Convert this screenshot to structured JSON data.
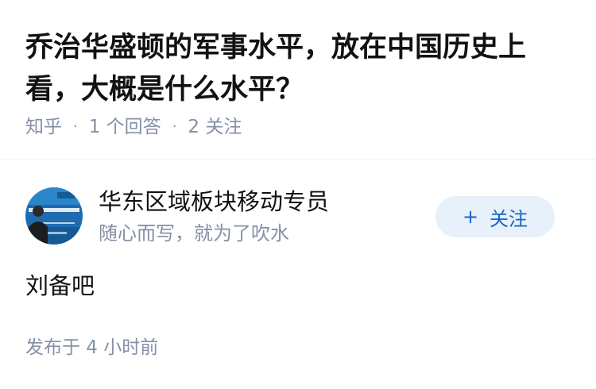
{
  "question": {
    "title": "乔治华盛顿的军事水平，放在中国历史上看，大概是什么水平？",
    "source": "知乎",
    "answer_count": "1 个回答",
    "follow_count": "2 关注"
  },
  "author": {
    "name": "华东区域板块移动专员",
    "headline": "随心而写，就为了吹水",
    "avatar_icon": "avatar-photo-icon",
    "follow_label": "关注",
    "follow_icon": "plus-icon"
  },
  "answer": {
    "content": "刘备吧",
    "time": "发布于 4 小时前"
  },
  "colors": {
    "text_primary": "#121212",
    "text_secondary": "#8590a6",
    "accent": "#1763c6",
    "follow_bg": "#e8f0fa"
  }
}
